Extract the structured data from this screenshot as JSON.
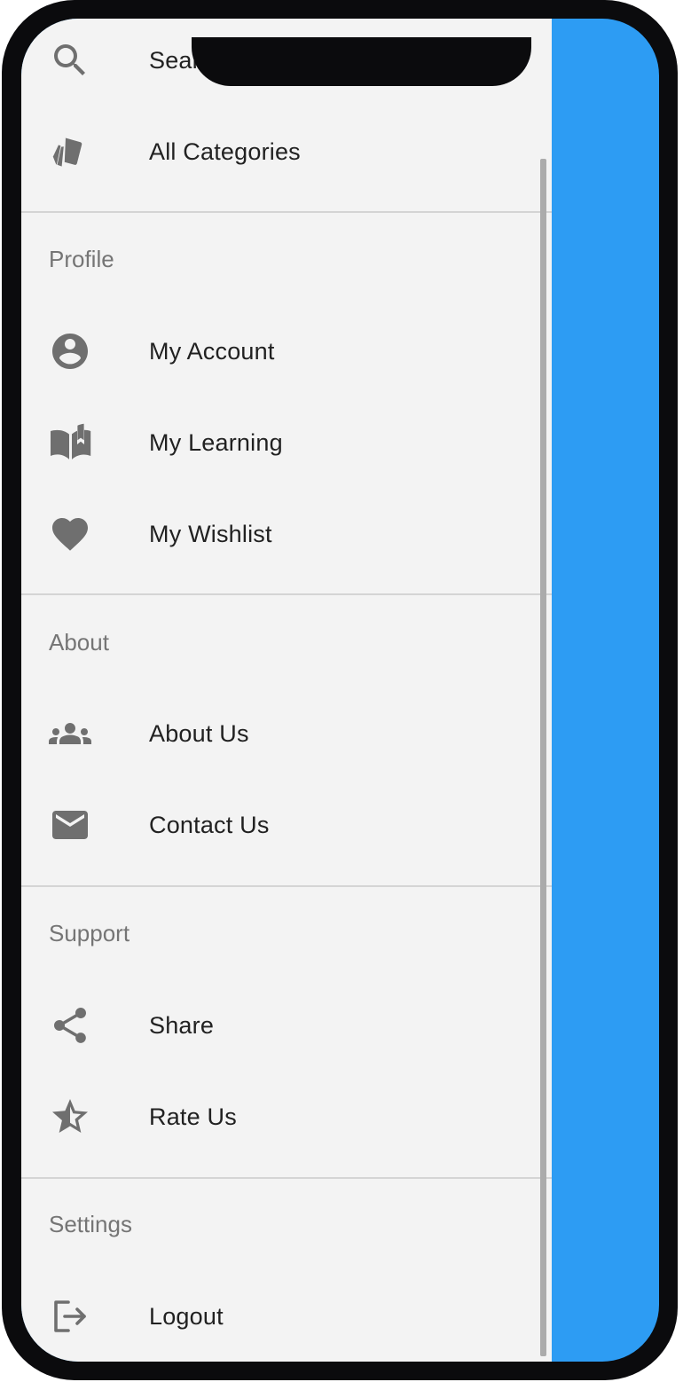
{
  "app": {
    "accent_color": "#2d9cf3",
    "drawer_background": "#f3f3f3"
  },
  "drawer": {
    "top_items": [
      {
        "label": "Search",
        "icon": "search-icon"
      },
      {
        "label": "All Categories",
        "icon": "category-tags-icon"
      }
    ],
    "sections": [
      {
        "header": "Profile",
        "items": [
          {
            "label": "My Account",
            "icon": "account-circle-icon"
          },
          {
            "label": "My Learning",
            "icon": "book-icon"
          },
          {
            "label": "My Wishlist",
            "icon": "heart-icon"
          }
        ]
      },
      {
        "header": "About",
        "items": [
          {
            "label": "About Us",
            "icon": "people-icon"
          },
          {
            "label": "Contact Us",
            "icon": "mail-icon"
          }
        ]
      },
      {
        "header": "Support",
        "items": [
          {
            "label": "Share",
            "icon": "share-icon"
          },
          {
            "label": "Rate Us",
            "icon": "star-half-icon"
          }
        ]
      },
      {
        "header": "Settings",
        "items": [
          {
            "label": "Logout",
            "icon": "logout-icon"
          }
        ]
      }
    ]
  }
}
